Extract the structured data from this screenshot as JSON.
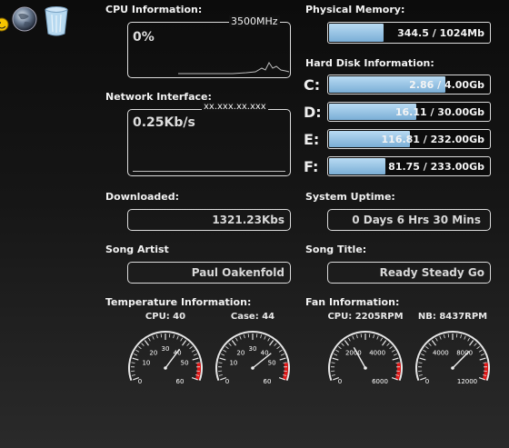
{
  "desktop_icons": [
    "smiley-icon",
    "globe-icon",
    "recycle-bin-icon"
  ],
  "cpu": {
    "title": "CPU Information:",
    "percent": "0%",
    "clock": "3500MHz"
  },
  "network": {
    "title": "Network Interface:",
    "ip": "xx.xxx.xx.xxx",
    "speed": "0.25Kb/s"
  },
  "downloaded": {
    "title": "Downloaded:",
    "value": "1321.23Kbs"
  },
  "memory": {
    "title": "Physical Memory:",
    "text": "344.5 / 1024Mb",
    "fill": 0.34
  },
  "disks": {
    "title": "Hard Disk Information:",
    "items": [
      {
        "drive": "C:",
        "text": "2.86 / 4.00Gb",
        "fill": 0.72
      },
      {
        "drive": "D:",
        "text": "16.11 / 30.00Gb",
        "fill": 0.54
      },
      {
        "drive": "E:",
        "text": "116.81 / 232.00Gb",
        "fill": 0.5
      },
      {
        "drive": "F:",
        "text": "81.75 / 233.00Gb",
        "fill": 0.35
      }
    ]
  },
  "uptime": {
    "title": "System Uptime:",
    "value": "0 Days 6 Hrs 30 Mins"
  },
  "song_artist": {
    "title": "Song Artist",
    "value": "Paul Oakenfold"
  },
  "song_title": {
    "title": "Song Title:",
    "value": "Ready Steady Go"
  },
  "temperature": {
    "title": "Temperature Information:",
    "gauges": [
      {
        "label": "CPU: 40",
        "value": 40,
        "max": 60,
        "ticks": [
          "0",
          "10",
          "20",
          "30",
          "40",
          "50",
          "60"
        ]
      },
      {
        "label": "Case: 44",
        "value": 44,
        "max": 60,
        "ticks": [
          "0",
          "10",
          "20",
          "30",
          "40",
          "50",
          "60"
        ]
      }
    ]
  },
  "fans": {
    "title": "Fan Information:",
    "gauges": [
      {
        "label": "CPU: 2205RPM",
        "value": 2205,
        "max": 6000,
        "ticks": [
          "0",
          "2000",
          "4000",
          "6000"
        ]
      },
      {
        "label": "NB: 8437RPM",
        "value": 8437,
        "max": 12000,
        "ticks": [
          "0",
          "4000",
          "8000",
          "12000"
        ]
      }
    ]
  }
}
